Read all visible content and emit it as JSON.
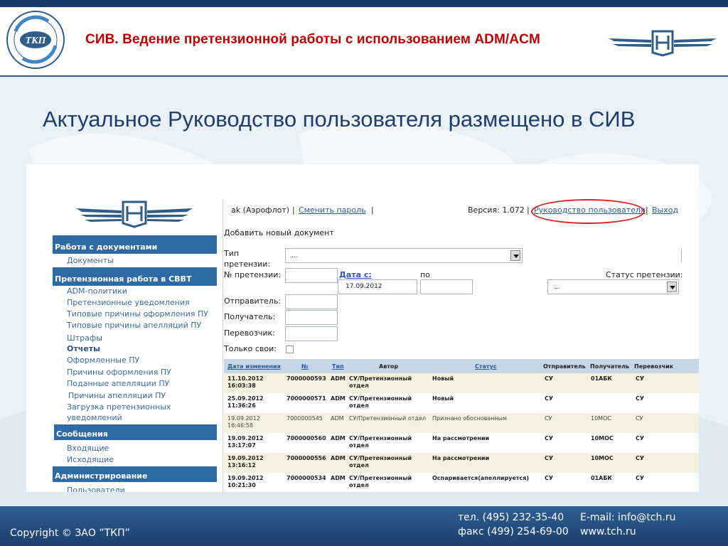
{
  "slide": {
    "title": "СИВ. Ведение претензионной работы с использованием ADM/ACM",
    "headline": "Актуальное Руководство пользователя размещено в СИВ",
    "copyright": "Copyright © ЗАО ”ТКП”",
    "contacts": {
      "phone": "тел.  (495) 232-35-40",
      "fax": "факс (499) 254-69-00",
      "email": "E-mail: info@tch.ru",
      "site": "www.tch.ru"
    },
    "logo_left_text": "ТКП",
    "title_color": "#c00000"
  },
  "sidebar": {
    "sections": [
      {
        "title": "Работа с документами",
        "items": [
          {
            "label": "Документы"
          }
        ]
      },
      {
        "title": "Претензионная работа в СВВТ",
        "items": [
          {
            "label": "ADM-политики"
          },
          {
            "label": "Претензионные уведомления"
          },
          {
            "label": "Типовые причины оформления ПУ"
          },
          {
            "label": "Типовые причины апелляций ПУ"
          },
          {
            "label": "Штрафы"
          },
          {
            "label": "Отчеты"
          },
          {
            "label": "Оформленные ПУ"
          },
          {
            "label": "Причины оформления ПУ"
          },
          {
            "label": "Поданные апелляции ПУ"
          },
          {
            "label": "Причины апелляции ПУ"
          },
          {
            "label": "Загрузка претензионных"
          },
          {
            "label": "уведомлений"
          }
        ]
      },
      {
        "title": "Сообщения",
        "items": [
          {
            "label": "Входящие"
          },
          {
            "label": "Исходящие"
          }
        ]
      },
      {
        "title": "Администрирование",
        "items": [
          {
            "label": "Пользователи"
          }
        ]
      }
    ]
  },
  "topbar": {
    "user": "ak (Аэрофлот)",
    "sep": "|",
    "change_password": "Сменить пароль",
    "version": "Версия: 1.072",
    "user_guide": "Руководство пользователя",
    "logout": "Выход"
  },
  "form": {
    "add_new_doc": "Добавить новый документ",
    "type_label_1": "Тип",
    "type_label_2": "претензии:",
    "type_value": "...",
    "claim_no_label": "№ претензии:",
    "date_from_label": "Дата с:",
    "date_from_value": "17.09.2012",
    "date_to_label": "по",
    "status_label": "Статус претензии:",
    "status_value": "...",
    "sender_label": "Отправитель:",
    "receiver_label": "Получатель:",
    "carrier_label": "Перевозчик:",
    "only_mine_label": "Только свои:"
  },
  "table": {
    "columns": [
      "Дата изменения",
      "№",
      "Тип",
      "Автор",
      "Статус",
      "Отправитель",
      "Получатель",
      "Перевозчик"
    ],
    "rows": [
      {
        "date": "11.10.2012 16:03:38",
        "no": "7000000593",
        "type": "ADM",
        "author": "СУ/Претензионный отдел",
        "status": "Новый",
        "sender": "СУ",
        "receiver": "01АБК",
        "carrier": "СУ",
        "bold": true
      },
      {
        "date": "25.09.2012 11:36:26",
        "no": "7000000571",
        "type": "ADM",
        "author": "СУ/Претензионный отдел",
        "status": "Новый",
        "sender": "СУ",
        "receiver": "",
        "carrier": "СУ",
        "bold": true
      },
      {
        "date": "19.09.2012 16:46:58",
        "no": "7000000545",
        "type": "ADM",
        "author": "СУ/Претензионный отдел",
        "status": "Признано обоснованным",
        "sender": "СУ",
        "receiver": "10МОС",
        "carrier": "СУ",
        "bold": false
      },
      {
        "date": "19.09.2012 13:17:07",
        "no": "7000000560",
        "type": "ADM",
        "author": "СУ/Претензионный отдел",
        "status": "На рассмотрении",
        "sender": "СУ",
        "receiver": "10МОС",
        "carrier": "СУ",
        "bold": true
      },
      {
        "date": "19.09.2012 13:16:12",
        "no": "7000000556",
        "type": "ADM",
        "author": "СУ/Претензионный отдел",
        "status": "На рассмотрении",
        "sender": "СУ",
        "receiver": "10МОС",
        "carrier": "СУ",
        "bold": true
      },
      {
        "date": "19.09.2012 10:21:30",
        "no": "7000000534",
        "type": "ADM",
        "author": "СУ/Претензионный отдел",
        "status": "Оспаривается(апеллируется)",
        "sender": "СУ",
        "receiver": "01АБК",
        "carrier": "СУ",
        "bold": true
      }
    ]
  },
  "colors": {
    "nav_section_bg": "#2e6aa6",
    "table_header_bg": "#c6d6e6",
    "row_alt_bg": "#f3f1de",
    "highlight_oval": "#e11c1c",
    "footer_bg": "#1f4c80"
  },
  "icons": [
    "tkp-logo-icon",
    "ns-wings-logo-icon",
    "dropdown-arrow-icon"
  ]
}
